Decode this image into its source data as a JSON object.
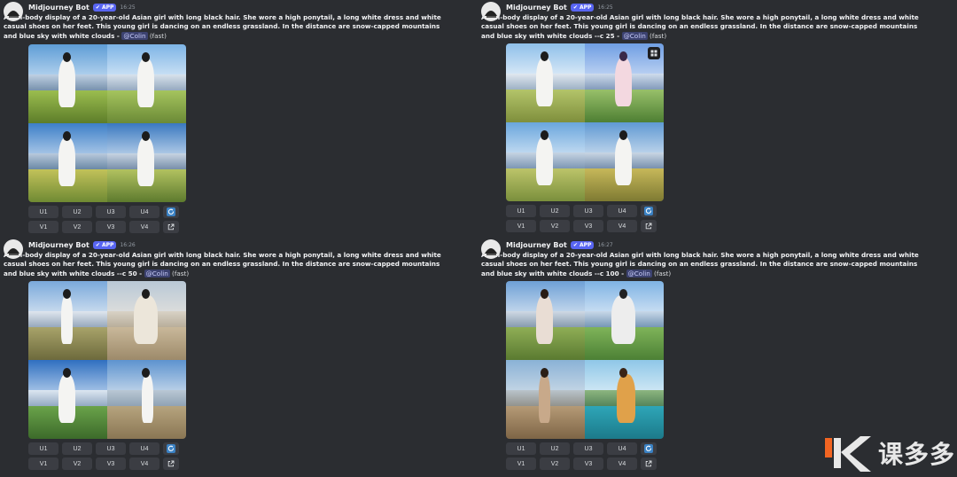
{
  "messages": [
    {
      "username": "Midjourney Bot",
      "badge": "APP",
      "time": "16:25",
      "prompt": "A full-body display of a 20-year-old Asian girl with long black hair. She wore a high ponytail, a long white dress and white casual shoes on her feet. This young girl is dancing on an endless grassland. In the distance are snow-capped mountains and blue sky with white clouds -",
      "mention": "@Colin",
      "speed": "(fast)",
      "upscale": [
        "U1",
        "U2",
        "U3",
        "U4"
      ],
      "variation": [
        "V1",
        "V2",
        "V3",
        "V4"
      ]
    },
    {
      "username": "Midjourney Bot",
      "badge": "APP",
      "time": "16:25",
      "prompt": "A full-body display of a 20-year-old Asian girl with long black hair. She wore a high ponytail, a long white dress and white casual shoes on her feet. This young girl is dancing on an endless grassland. In the distance are snow-capped mountains and blue sky with white clouds --c 25 -",
      "mention": "@Colin",
      "speed": "(fast)",
      "upscale": [
        "U1",
        "U2",
        "U3",
        "U4"
      ],
      "variation": [
        "V1",
        "V2",
        "V3",
        "V4"
      ]
    },
    {
      "username": "Midjourney Bot",
      "badge": "APP",
      "time": "16:26",
      "prompt": "A full-body display of a 20-year-old Asian girl with long black hair. She wore a high ponytail, a long white dress and white casual shoes on her feet. This young girl is dancing on an endless grassland. In the distance are snow-capped mountains and blue sky with white clouds --c 50 -",
      "mention": "@Colin",
      "speed": "(fast)",
      "upscale": [
        "U1",
        "U2",
        "U3",
        "U4"
      ],
      "variation": [
        "V1",
        "V2",
        "V3",
        "V4"
      ]
    },
    {
      "username": "Midjourney Bot",
      "badge": "APP",
      "time": "16:27",
      "prompt": "A full-body display of a 20-year-old Asian girl with long black hair. She wore a high ponytail, a long white dress and white casual shoes on her feet. This young girl is dancing on an endless grassland. In the distance are snow-capped mountains and blue sky with white clouds --c 100 -",
      "mention": "@Colin",
      "speed": "(fast)",
      "upscale": [
        "U1",
        "U2",
        "U3",
        "U4"
      ],
      "variation": [
        "V1",
        "V2",
        "V3",
        "V4"
      ]
    }
  ],
  "watermark": {
    "text": "课多多"
  },
  "icons": {
    "reroll": "refresh-icon",
    "web": "open-external-icon",
    "expand": "expand-icon",
    "badge": "verified-check-icon"
  },
  "colors": {
    "background": "#2b2d31",
    "button": "#3b3d43",
    "accent": "#5865f2",
    "reroll": "#3b82c4",
    "watermark_orange": "#f26522"
  }
}
